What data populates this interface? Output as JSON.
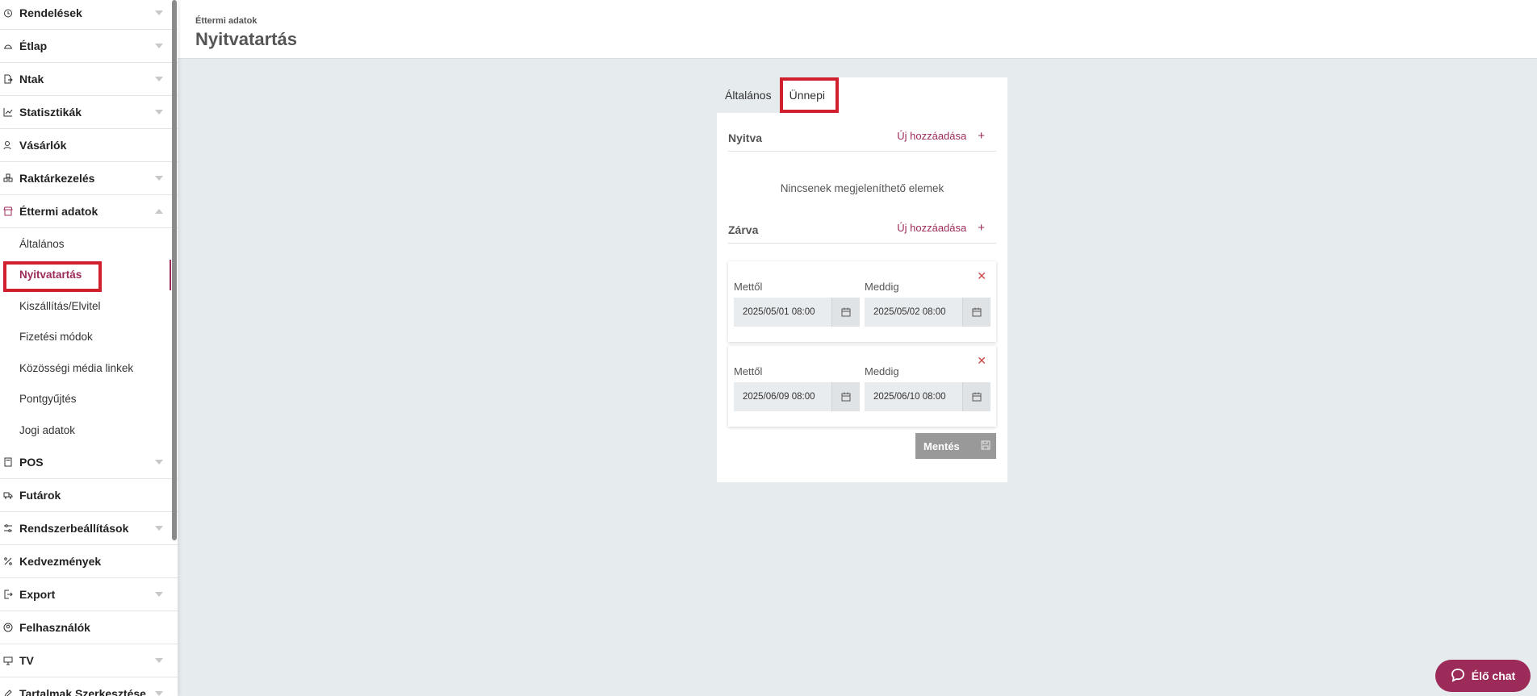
{
  "sidebar": {
    "items_top": [
      {
        "label": "Rendelések",
        "icon": "alarm-clock-icon",
        "chevron": "down"
      },
      {
        "label": "Étlap",
        "icon": "cloche-icon",
        "chevron": "down"
      },
      {
        "label": "Ntak",
        "icon": "document-export-icon",
        "chevron": "down"
      },
      {
        "label": "Statisztikák",
        "icon": "chart-icon",
        "chevron": "down"
      },
      {
        "label": "Vásárlók",
        "icon": "users-icon",
        "chevron": "none"
      },
      {
        "label": "Raktárkezelés",
        "icon": "boxes-icon",
        "chevron": "down"
      },
      {
        "label": "Éttermi adatok",
        "icon": "store-icon",
        "chevron": "up"
      }
    ],
    "sub_items": [
      {
        "label": "Általános",
        "active": false
      },
      {
        "label": "Nyitvatartás",
        "active": true
      },
      {
        "label": "Kiszállítás/Elvitel",
        "active": false
      },
      {
        "label": "Fizetési módok",
        "active": false
      },
      {
        "label": "Közösségi média linkek",
        "active": false
      },
      {
        "label": "Pontgyűjtés",
        "active": false
      },
      {
        "label": "Jogi adatok",
        "active": false
      }
    ],
    "items_bottom": [
      {
        "label": "POS",
        "icon": "calculator-icon",
        "chevron": "down"
      },
      {
        "label": "Futárok",
        "icon": "truck-icon",
        "chevron": "none"
      },
      {
        "label": "Rendszerbeállítások",
        "icon": "sliders-icon",
        "chevron": "down"
      },
      {
        "label": "Kedvezmények",
        "icon": "percent-icon",
        "chevron": "none"
      },
      {
        "label": "Export",
        "icon": "export-icon",
        "chevron": "down"
      },
      {
        "label": "Felhasználók",
        "icon": "user-circle-icon",
        "chevron": "none"
      },
      {
        "label": "TV",
        "icon": "monitor-icon",
        "chevron": "down"
      },
      {
        "label": "Tartalmak Szerkesztése",
        "icon": "edit-icon",
        "chevron": "down"
      }
    ]
  },
  "header": {
    "breadcrumb": "Éttermi adatok",
    "title": "Nyitvatartás"
  },
  "tabs": [
    {
      "label": "Általános",
      "active": false
    },
    {
      "label": "Ünnepi",
      "active": true
    }
  ],
  "open_section": {
    "title": "Nyitva",
    "add_label": "Új hozzáadása",
    "add_icon": "plus-icon",
    "empty_text": "Nincsenek megjeleníthető elemek"
  },
  "closed_section": {
    "title": "Zárva",
    "add_label": "Új hozzáadása",
    "add_icon": "plus-icon",
    "ranges": [
      {
        "from_label": "Mettől",
        "from_value": "2025/05/01 08:00",
        "to_label": "Meddig",
        "to_value": "2025/05/02 08:00"
      },
      {
        "from_label": "Mettől",
        "from_value": "2025/06/09 08:00",
        "to_label": "Meddig",
        "to_value": "2025/06/10 08:00"
      }
    ]
  },
  "save_button": {
    "label": "Mentés",
    "icon": "floppy-disk-icon"
  },
  "chat_button": {
    "label": "Élő chat",
    "icon": "chat-bubble-icon"
  },
  "colors": {
    "accent": "#9c2b5a",
    "highlight_box": "#d0202e",
    "background": "#e6ebee",
    "save_button_bg": "#999999"
  }
}
